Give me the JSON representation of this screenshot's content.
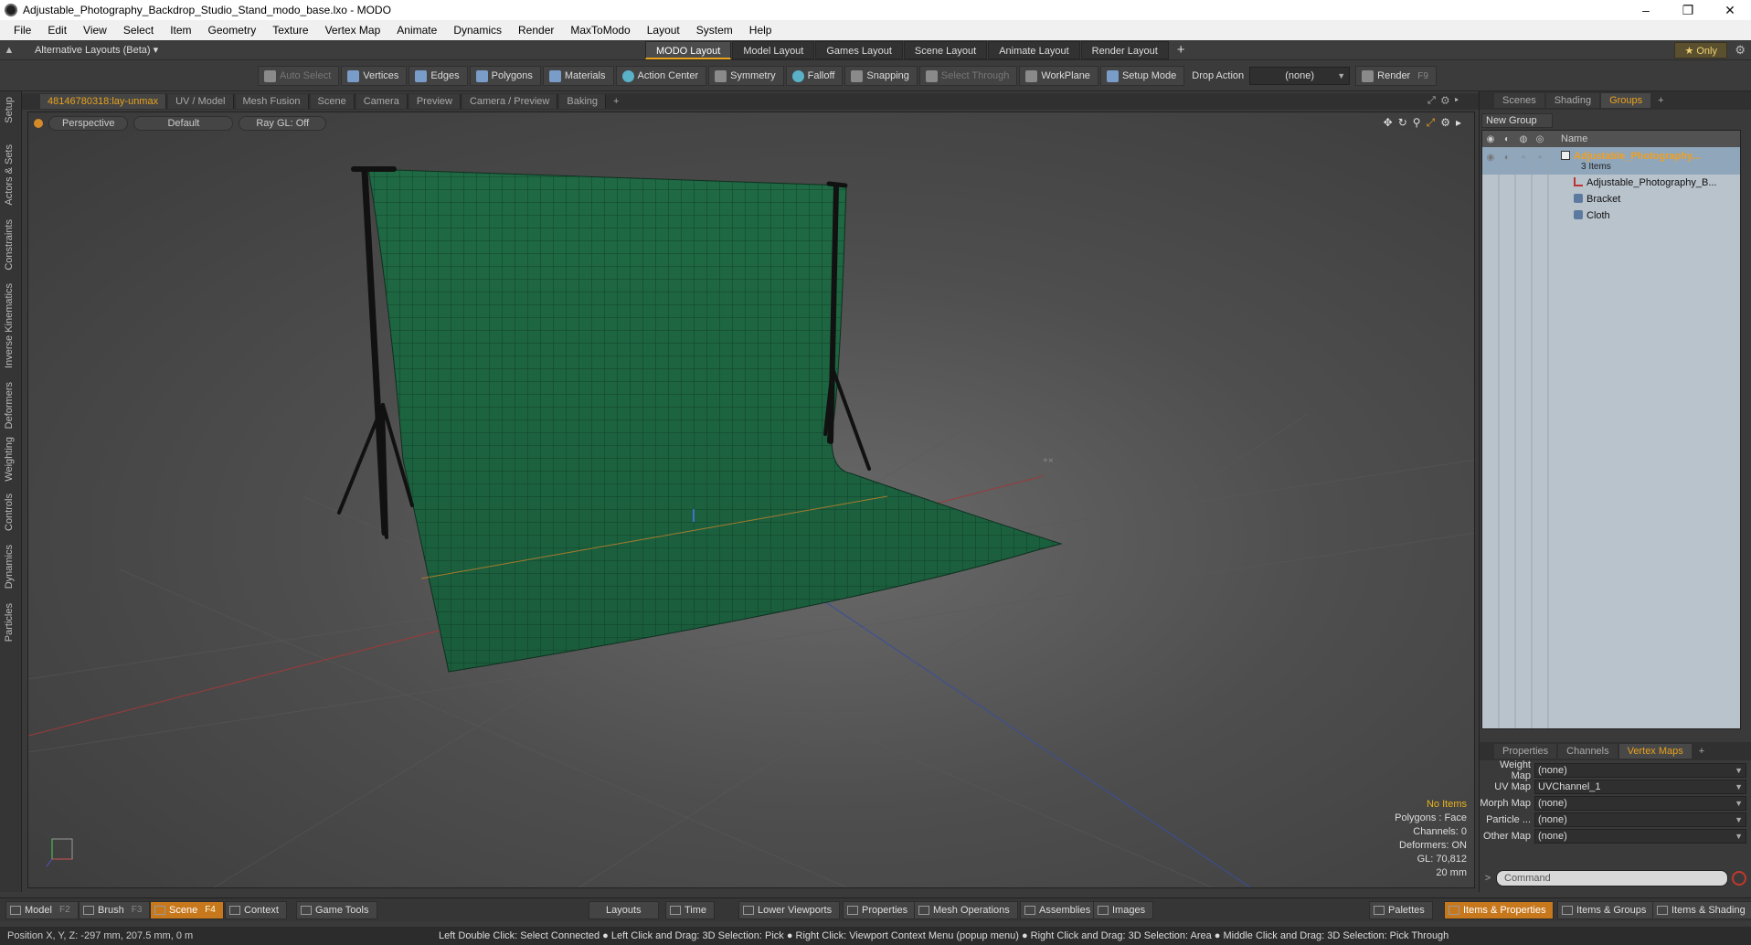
{
  "window": {
    "title": "Adjustable_Photography_Backdrop_Studio_Stand_modo_base.lxo - MODO",
    "minimize": "–",
    "restore": "❐",
    "close": "✕"
  },
  "menu": [
    "File",
    "Edit",
    "View",
    "Select",
    "Item",
    "Geometry",
    "Texture",
    "Vertex Map",
    "Animate",
    "Dynamics",
    "Render",
    "MaxToModo",
    "Layout",
    "System",
    "Help"
  ],
  "layoutbar": {
    "alt_layout": "Alternative Layouts (Beta) ▾",
    "tabs": [
      "MODO Layout",
      "Model Layout",
      "Games Layout",
      "Scene Layout",
      "Animate Layout",
      "Render Layout"
    ],
    "active_tab": "MODO Layout",
    "plus": "+",
    "only": "★  Only"
  },
  "toolbar": {
    "auto_select": "Auto Select",
    "vertices": "Vertices",
    "edges": "Edges",
    "polygons": "Polygons",
    "materials": "Materials",
    "action_center": "Action Center",
    "symmetry": "Symmetry",
    "falloff": "Falloff",
    "snapping": "Snapping",
    "select_through": "Select Through",
    "workplane": "WorkPlane",
    "setup_mode": "Setup Mode",
    "drop_action_label": "Drop Action",
    "drop_action_value": "(none)",
    "render": "Render",
    "render_key": "F9"
  },
  "left_tabs": [
    "Setup",
    "Actors & Sets",
    "Constraints",
    "Inverse Kinematics",
    "Deformers",
    "Weighting",
    "Controls",
    "Dynamics",
    "Particles"
  ],
  "viewport_tabs": [
    "48146780318:lay-unmax",
    "UV / Model",
    "Mesh Fusion",
    "Scene",
    "Camera",
    "Preview",
    "Camera / Preview",
    "Baking"
  ],
  "viewport_tab_plus": "+",
  "viewport": {
    "view": "Perspective",
    "shading": "Default",
    "raygl": "Ray GL: Off",
    "stats": {
      "items": "No Items",
      "polygons": "Polygons : Face",
      "channels": "Channels: 0",
      "deformers": "Deformers: ON",
      "gl": "GL: 70,812",
      "scale": "20 mm"
    }
  },
  "right_panel": {
    "tabs": [
      "Scenes",
      "Shading",
      "Groups"
    ],
    "active_tab": "Groups",
    "plus": "+",
    "new_group": "New Group",
    "name_header": "Name",
    "root": {
      "name": "Adjustable_Photography...",
      "count": "3 Items"
    },
    "items": [
      "Adjustable_Photography_B...",
      "Bracket",
      "Cloth"
    ],
    "bottom_tabs": [
      "Properties",
      "Channels",
      "Vertex Maps"
    ],
    "bottom_active": "Vertex Maps",
    "vertex_maps": [
      {
        "label": "Weight Map",
        "value": "(none)"
      },
      {
        "label": "UV Map",
        "value": "UVChannel_1"
      },
      {
        "label": "Morph Map",
        "value": "(none)"
      },
      {
        "label": "Particle  ...",
        "value": "(none)"
      },
      {
        "label": "Other Map",
        "value": "(none)"
      }
    ],
    "command_placeholder": "Command"
  },
  "bottom_bar": {
    "model": "Model",
    "model_key": "F2",
    "brush": "Brush",
    "brush_key": "F3",
    "scene": "Scene",
    "scene_key": "F4",
    "context": "Context",
    "game_tools": "Game Tools",
    "layouts": "Layouts",
    "time": "Time",
    "lower_viewports": "Lower Viewports",
    "properties": "Properties",
    "mesh_operations": "Mesh Operations",
    "assemblies": "Assemblies",
    "images": "Images",
    "palettes": "Palettes",
    "items_properties": "Items & Properties",
    "items_groups": "Items & Groups",
    "items_shading": "Items & Shading"
  },
  "status": {
    "position": "Position X, Y, Z:   -297 mm, 207.5 mm, 0 m",
    "hints": "Left Double Click: Select Connected ● Left Click and Drag: 3D Selection: Pick ● Right Click: Viewport Context Menu (popup menu) ● Right Click and Drag: 3D Selection: Area ● Middle Click and Drag: 3D Selection: Pick Through"
  }
}
